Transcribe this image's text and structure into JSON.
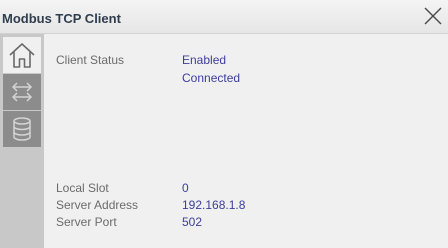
{
  "window": {
    "title": "Modbus TCP Client"
  },
  "sidebar": {
    "items": [
      {
        "icon": "home-icon",
        "active": true
      },
      {
        "icon": "transfer-arrows-icon",
        "active": false
      },
      {
        "icon": "database-icon",
        "active": false
      }
    ]
  },
  "status": {
    "client_status_label": "Client Status",
    "enabled_value": "Enabled",
    "connected_value": "Connected"
  },
  "details": {
    "local_slot_label": "Local Slot",
    "local_slot_value": "0",
    "server_address_label": "Server Address",
    "server_address_value": "192.168.1.8",
    "server_port_label": "Server Port",
    "server_port_value": "502"
  },
  "colors": {
    "value_text": "#3d3d9a",
    "label_text": "#6b6b6b",
    "sidebar_bg": "#c8c8c8",
    "active_button_bg": "#f0f0f0",
    "inactive_button_bg": "#8c8c8c"
  }
}
